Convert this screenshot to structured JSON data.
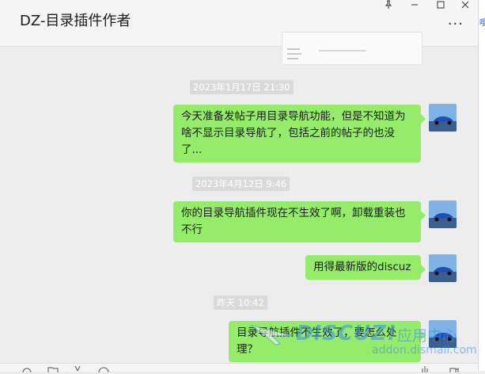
{
  "window": {
    "title": "DZ-目录插件作者",
    "pin_icon": "pin-icon",
    "minimize_icon": "minimize-icon",
    "maximize_icon": "maximize-icon",
    "close_icon": "close-icon",
    "more_label": "···"
  },
  "right_strip": {
    "glyph": "嘤"
  },
  "messages": [
    {
      "type": "timestamp",
      "text": "2023年1月17日 21:30"
    },
    {
      "type": "bubble",
      "text": "今天准备发帖子用目录导航功能，但是不知道为啥不显示目录导航了，包括之前的帖子的也没了..."
    },
    {
      "type": "timestamp",
      "text": "2023年4月12日 9:46"
    },
    {
      "type": "bubble",
      "text": "你的目录导航插件现在不生效了啊，卸载重装也不行"
    },
    {
      "type": "bubble",
      "text": "用得最新版的discuz"
    },
    {
      "type": "timestamp",
      "text": "昨天 10:42"
    },
    {
      "type": "bubble",
      "text": "目录导航插件不生效了，要怎么处理？"
    }
  ],
  "watermark": {
    "logo": "DISCUZ!",
    "sub": "应用中心",
    "url": "addon.dismall.com"
  },
  "colors": {
    "bubble": "#95ec69",
    "background": "#ededed",
    "timestamp_bg": "#dadada",
    "watermark": "#3c8df0"
  },
  "toolbar_icons": [
    "emoji-icon",
    "folder-icon",
    "scissors-icon",
    "chat-history-icon",
    "voice-icon",
    "video-call-icon"
  ]
}
